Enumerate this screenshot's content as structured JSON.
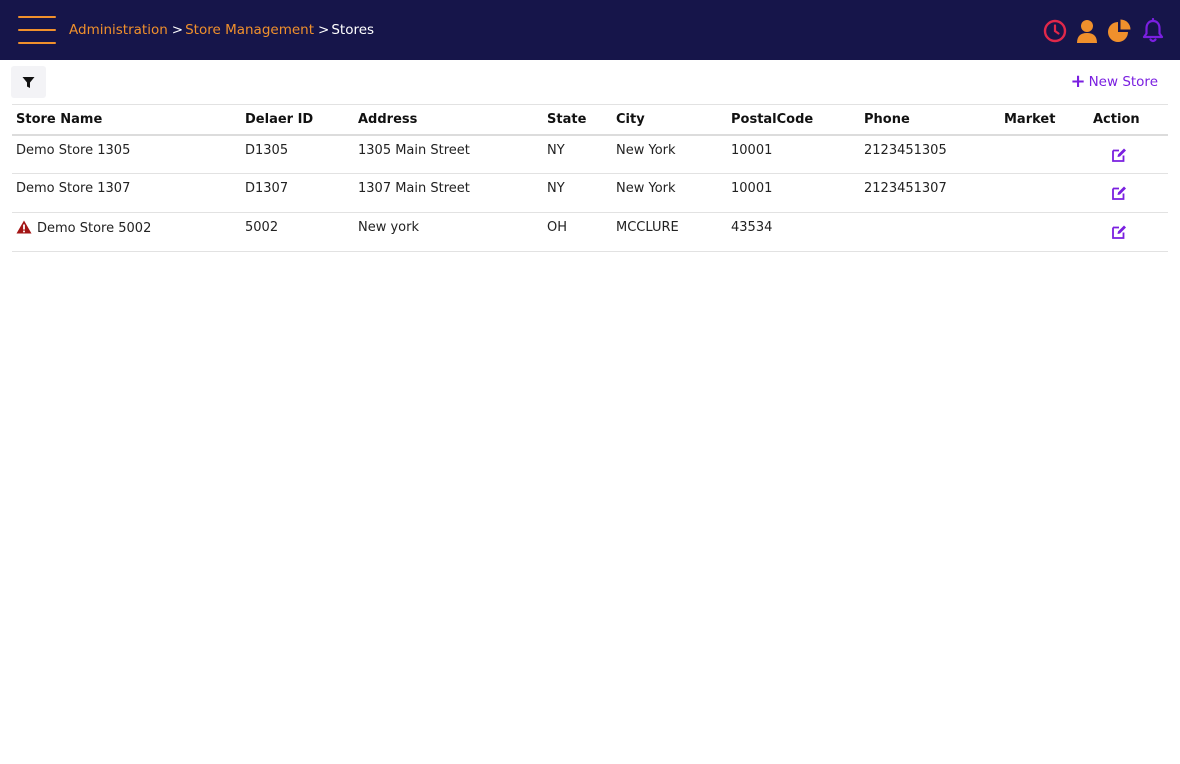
{
  "header": {
    "breadcrumb": {
      "items": [
        "Administration",
        "Store Management"
      ],
      "separator": ">",
      "current": "Stores"
    },
    "icons": [
      "history-icon",
      "user-icon",
      "pie-chart-icon",
      "bell-icon"
    ]
  },
  "toolbar": {
    "new_store_label": "New Store",
    "filter_icon": "filter-icon"
  },
  "table": {
    "columns": [
      "Store Name",
      "Delaer ID",
      "Address",
      "State",
      "City",
      "PostalCode",
      "Phone",
      "Market",
      "Action"
    ],
    "rows": [
      {
        "store_name": "Demo Store 1305",
        "dealer_id": "D1305",
        "address": "1305 Main Street",
        "state": "NY",
        "city": "New York",
        "postal_code": "10001",
        "phone": "2123451305",
        "market": "",
        "warning": false
      },
      {
        "store_name": "Demo Store 1307",
        "dealer_id": "D1307",
        "address": "1307 Main Street",
        "state": "NY",
        "city": "New York",
        "postal_code": "10001",
        "phone": "2123451307",
        "market": "",
        "warning": false
      },
      {
        "store_name": "Demo Store 5002",
        "dealer_id": "5002",
        "address": "New york",
        "state": "OH",
        "city": "MCCLURE",
        "postal_code": "43534",
        "phone": "",
        "market": "",
        "warning": true
      }
    ]
  },
  "colors": {
    "header_bg": "#16154a",
    "accent_orange": "#f0902c",
    "accent_purple": "#7a1fe0",
    "history_red": "#e0284a",
    "warning_red": "#a31515"
  }
}
